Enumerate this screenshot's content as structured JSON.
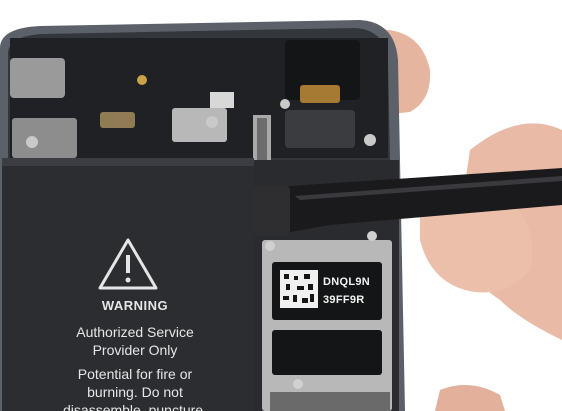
{
  "photo": {
    "warning_label": {
      "title": "WARNING",
      "lines": [
        "Authorized Service",
        "Provider Only",
        "Potential for fire or",
        "burning. Do not",
        "disassemble, puncture,"
      ]
    },
    "chip_label": {
      "lines": [
        "DNQL9N",
        "39FF9R"
      ]
    },
    "colors": {
      "background": "#ffffff",
      "phone_frame": "#5c6068",
      "battery": "#2b2d31",
      "logic_board": "#1d1e20",
      "spudger": "#1a1a1c",
      "skin": "#e8b8a4"
    }
  }
}
